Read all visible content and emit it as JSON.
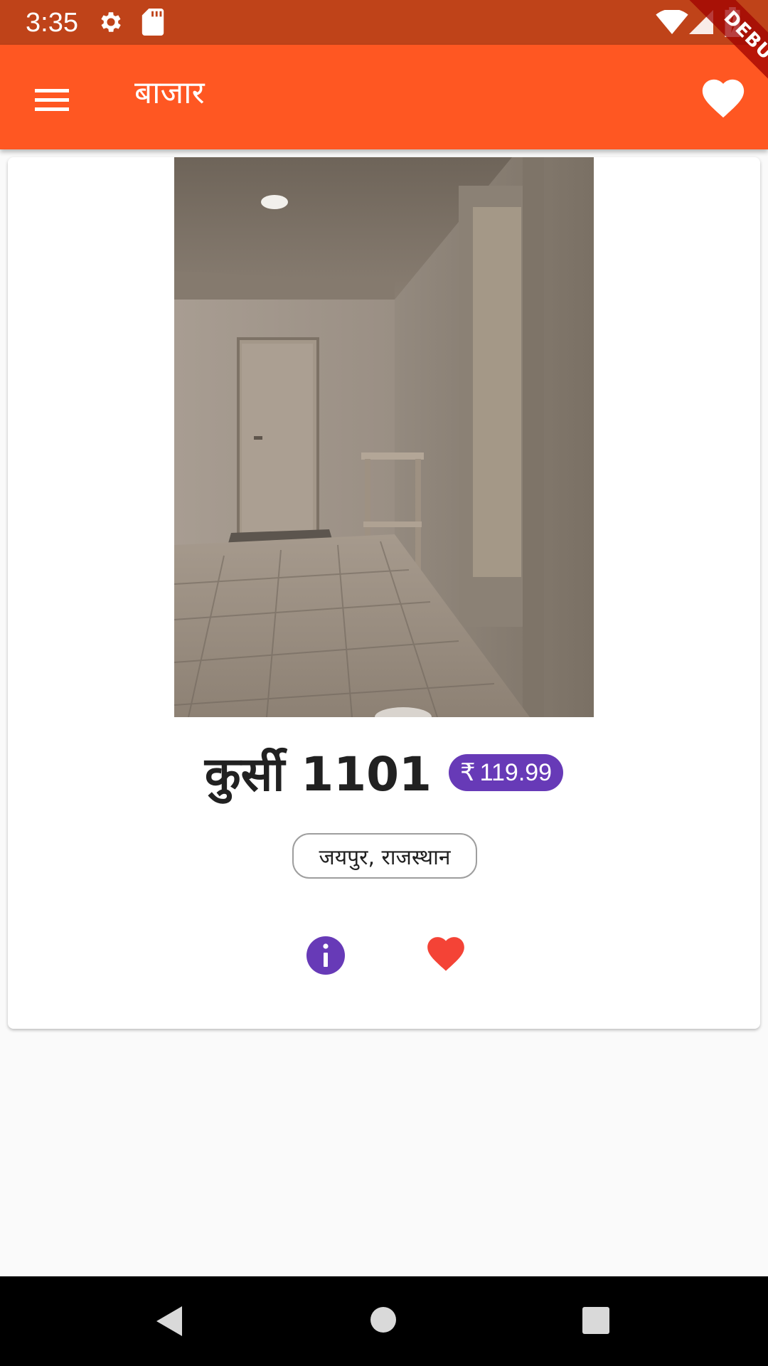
{
  "status_bar": {
    "time": "3:35",
    "icons": [
      "settings-icon",
      "sd-card-icon",
      "wifi-icon",
      "signal-icon",
      "battery-charging-icon"
    ]
  },
  "app_bar": {
    "title": "बाजार",
    "menu_icon": "menu-icon",
    "favorites_icon": "heart-icon"
  },
  "debug_banner": "DEBUG",
  "product": {
    "title": "कुर्सी 1101",
    "price_symbol": "₹",
    "price": "119.99",
    "location": "जयपुर, राजस्थान",
    "info_icon": "info-icon",
    "like_icon": "heart-icon"
  },
  "nav_bar": {
    "icons": [
      "back-icon",
      "home-icon",
      "recents-icon"
    ]
  },
  "colors": {
    "status_bar": "#BF4319",
    "app_bar": "#FF5722",
    "price_badge": "#673AB7",
    "info_icon": "#673AB7",
    "like_icon": "#F44336"
  }
}
